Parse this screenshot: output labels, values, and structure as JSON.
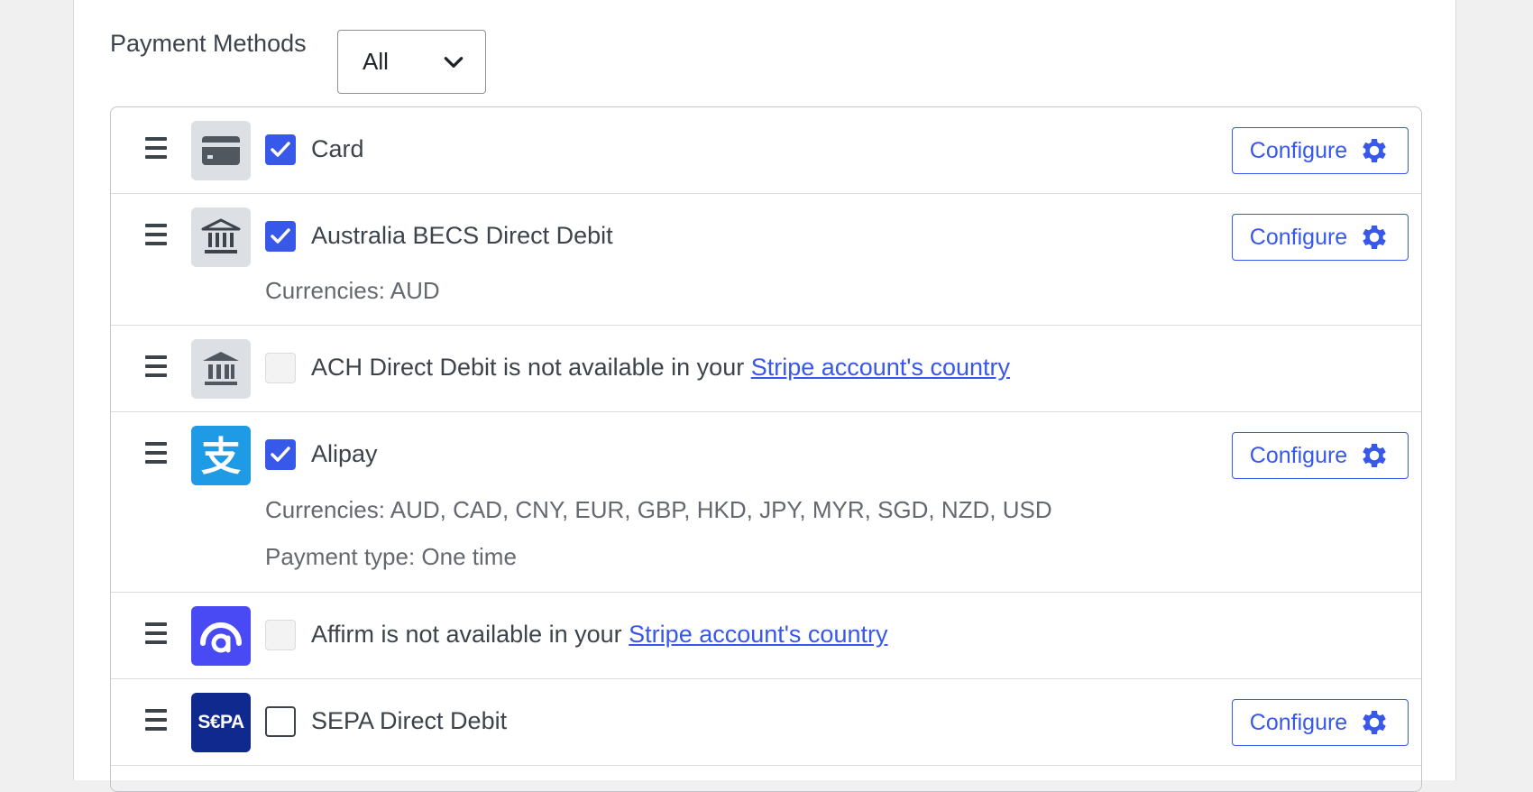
{
  "filter": {
    "label": "Payment Methods",
    "selected": "All"
  },
  "methods": [
    {
      "name": "Card",
      "logo": "card-icon",
      "state": "checked",
      "configure": "Configure"
    },
    {
      "name": "Australia BECS Direct Debit",
      "logo": "bank-icon",
      "state": "checked",
      "currencies": "Currencies: AUD",
      "configure": "Configure"
    },
    {
      "name": "ACH Direct Debit is not available in your ",
      "link": "Stripe account's country",
      "logo": "bank-icon",
      "state": "disabled"
    },
    {
      "name": "Alipay",
      "logo": "alipay-icon",
      "state": "checked",
      "currencies": "Currencies: AUD, CAD, CNY, EUR, GBP, HKD, JPY, MYR, SGD, NZD, USD",
      "payment_type": "Payment type: One time",
      "configure": "Configure"
    },
    {
      "name": "Affirm is not available in your ",
      "link": "Stripe account's country",
      "logo": "affirm-icon",
      "state": "disabled"
    },
    {
      "name": "SEPA Direct Debit",
      "logo": "sepa-icon",
      "logo_text": "S€PA",
      "state": "unchecked",
      "configure": "Configure"
    }
  ],
  "colors": {
    "accent": "#3858e9",
    "alipay": "#1f9be6",
    "affirm": "#4a4af4",
    "sepa": "#10298e"
  }
}
